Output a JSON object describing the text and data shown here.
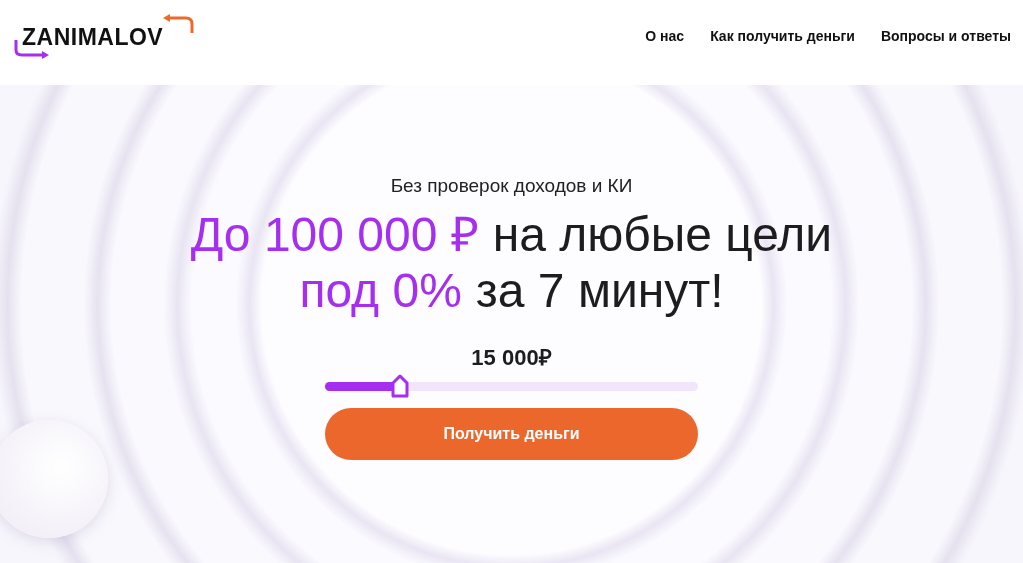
{
  "header": {
    "logo": "ZANIMALOV",
    "nav": [
      {
        "label": "О нас"
      },
      {
        "label": "Как получить деньги"
      },
      {
        "label": "Вопросы и ответы"
      }
    ]
  },
  "hero": {
    "subtitle": "Без проверок доходов и КИ",
    "headline": [
      [
        {
          "text": "До 100 000 ₽",
          "accent": true
        },
        {
          "text": "на любые цели",
          "accent": false
        }
      ],
      [
        {
          "text": "под 0%",
          "accent": true
        },
        {
          "text": "за 7 минут!",
          "accent": false
        }
      ]
    ],
    "amount": "15 000₽",
    "slider": {
      "level": 0.2
    },
    "button": "Получить деньги"
  }
}
